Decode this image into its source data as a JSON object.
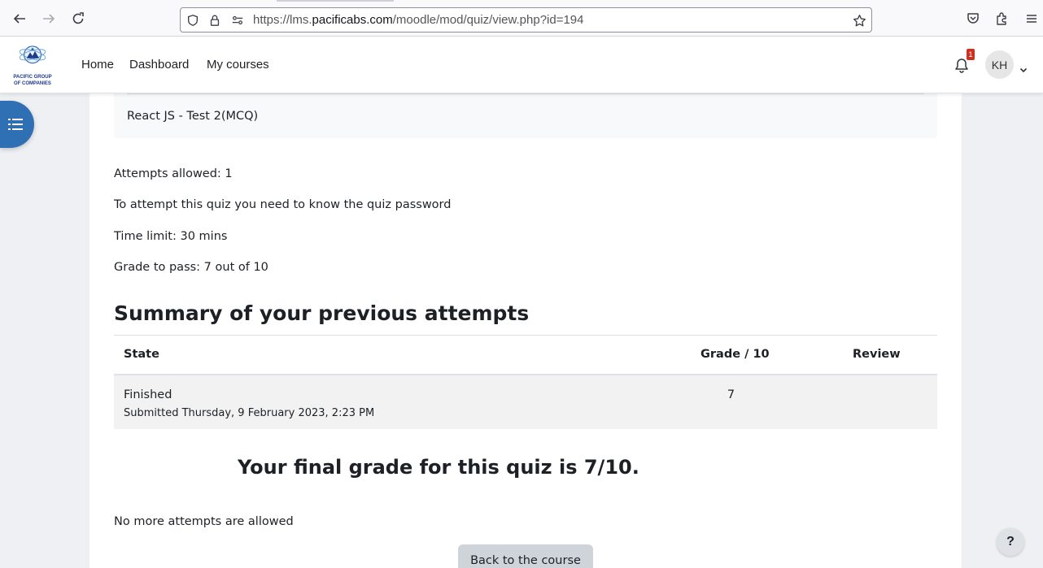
{
  "browser": {
    "url_prefix": "https://lms.",
    "url_domain": "pacificabs.com",
    "url_path": "/moodle/mod/quiz/view.php?id=194",
    "icons": [
      "back-icon",
      "forward-icon",
      "reload-icon",
      "shield-icon",
      "lock-icon",
      "permissions-icon",
      "bookmark-star-icon",
      "pocket-icon",
      "extensions-icon",
      "menu-icon"
    ]
  },
  "navbar": {
    "logo_text_line1": "PACIFIC GROUP",
    "logo_text_line2": "OF COMPANIES",
    "links": [
      "Home",
      "Dashboard",
      "My courses"
    ],
    "notification_count": "1",
    "avatar_initials": "KH"
  },
  "quiz": {
    "description": "React JS - Test 2(MCQ)",
    "info": [
      "Attempts allowed: 1",
      "To attempt this quiz you need to know the quiz password",
      "Time limit: 30 mins",
      "Grade to pass: 7 out of 10"
    ],
    "summary_title": "Summary of your previous attempts",
    "table": {
      "headers": [
        "State",
        "Grade / 10",
        "Review"
      ],
      "rows": [
        {
          "state": "Finished",
          "submitted": "Submitted Thursday, 9 February 2023, 2:23 PM",
          "grade": "7",
          "review": ""
        }
      ]
    },
    "final_grade": "Your final grade for this quiz is 7/10.",
    "no_more_attempts": "No more attempts are allowed",
    "back_button": "Back to the course"
  },
  "help_label": "?",
  "colors": {
    "drawer_toggle": "#2f6fb4",
    "badge": "#ca3120",
    "button_bg": "#ced4da"
  }
}
